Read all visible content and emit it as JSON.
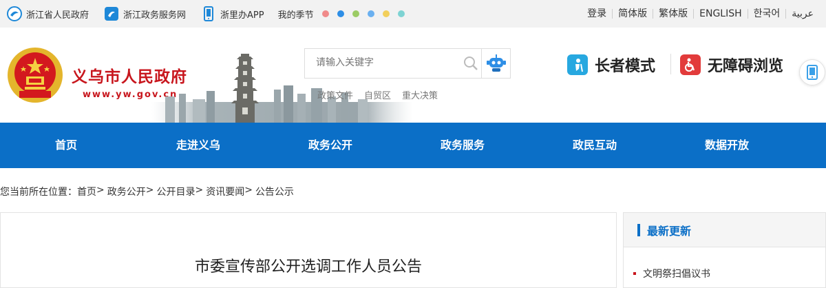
{
  "topbar": {
    "links": [
      {
        "label": "浙江省人民政府",
        "icon": "zhejiang-gov-icon"
      },
      {
        "label": "浙江政务服务网",
        "icon": "zj-service-icon"
      },
      {
        "label": "浙里办APP",
        "icon": "mobile-app-icon"
      }
    ],
    "season_label": "我的季节",
    "season_colors": [
      "#f08a8a",
      "#2d8ee6",
      "#9ccc65",
      "#6ab0f0",
      "#f2cf5b",
      "#7ed3d3"
    ],
    "right_links": [
      "登录",
      "简体版",
      "繁体版",
      "ENGLISH",
      "한국어",
      "عربية"
    ]
  },
  "header": {
    "site_title": "义乌市人民政府",
    "site_url": "www.yw.gov.cn",
    "search_placeholder": "请输入关键字",
    "hot_words": [
      "政策文件",
      "自贸区",
      "重大决策"
    ],
    "elder_mode": "长者模式",
    "accessible_browse": "无障碍浏览"
  },
  "nav": [
    "首页",
    "走进义乌",
    "政务公开",
    "政务服务",
    "政民互动",
    "数据开放"
  ],
  "breadcrumb": {
    "prefix": "您当前所在位置：",
    "items": [
      "首页",
      "政务公开",
      "公开目录",
      "资讯要闻",
      "公告公示"
    ],
    "separator": ">"
  },
  "article": {
    "title": "市委宣传部公开选调工作人员公告"
  },
  "sidebar": {
    "title": "最新更新",
    "items": [
      "文明祭扫倡议书"
    ]
  },
  "colors": {
    "brand_red": "#c8161d",
    "nav_blue": "#0b6fc7"
  }
}
